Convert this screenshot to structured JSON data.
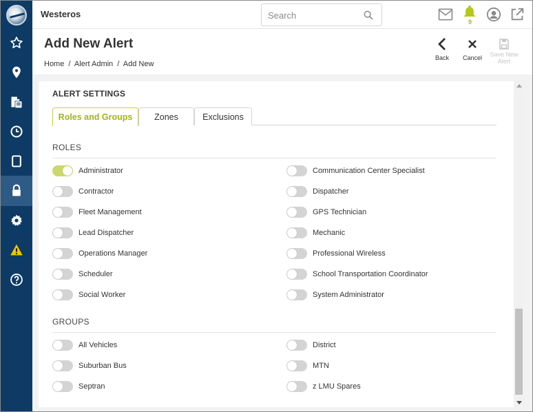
{
  "app": {
    "title": "Westeros"
  },
  "search": {
    "placeholder": "Search"
  },
  "notifications": {
    "count": "9"
  },
  "page": {
    "title": "Add New Alert",
    "breadcrumb": [
      "Home",
      "/",
      "Alert Admin",
      "/",
      "Add New"
    ]
  },
  "actions": {
    "back": "Back",
    "cancel": "Cancel",
    "save_line1": "Save New",
    "save_line2": "Alert"
  },
  "sidebar": {
    "items": [
      {
        "icon": "star-icon"
      },
      {
        "icon": "map-pin-icon"
      },
      {
        "icon": "documents-icon"
      },
      {
        "icon": "clock-icon"
      },
      {
        "icon": "tablet-icon"
      },
      {
        "icon": "lock-icon",
        "active": true
      },
      {
        "icon": "gear-icon"
      },
      {
        "icon": "warning-icon"
      },
      {
        "icon": "help-icon"
      }
    ]
  },
  "settings": {
    "section_title": "ALERT SETTINGS",
    "tabs": [
      "Roles and Groups",
      "Zones",
      "Exclusions"
    ],
    "active_tab": "Roles and Groups",
    "roles_title": "ROLES",
    "groups_title": "GROUPS",
    "roles_left": [
      {
        "label": "Administrator",
        "on": true
      },
      {
        "label": "Contractor",
        "on": false
      },
      {
        "label": "Fleet Management",
        "on": false
      },
      {
        "label": "Lead Dispatcher",
        "on": false
      },
      {
        "label": "Operations Manager",
        "on": false
      },
      {
        "label": "Scheduler",
        "on": false
      },
      {
        "label": "Social Worker",
        "on": false
      }
    ],
    "roles_right": [
      {
        "label": "Communication Center Specialist",
        "on": false
      },
      {
        "label": "Dispatcher",
        "on": false
      },
      {
        "label": "GPS Technician",
        "on": false
      },
      {
        "label": "Mechanic",
        "on": false
      },
      {
        "label": "Professional Wireless",
        "on": false
      },
      {
        "label": "School Transportation Coordinator",
        "on": false
      },
      {
        "label": "System Administrator",
        "on": false
      }
    ],
    "groups_left": [
      {
        "label": "All Vehicles",
        "on": false
      },
      {
        "label": "Suburban Bus",
        "on": false
      },
      {
        "label": "Septran",
        "on": false
      }
    ],
    "groups_right": [
      {
        "label": "District",
        "on": false
      },
      {
        "label": "MTN",
        "on": false
      },
      {
        "label": "z LMU Spares",
        "on": false
      }
    ]
  },
  "colors": {
    "sidebar": "#0d3b66",
    "sidebar_active": "#2e5a86",
    "accent": "#c3d13a",
    "toggle_on": "#ccd86a",
    "bell": "#b5c71f"
  }
}
